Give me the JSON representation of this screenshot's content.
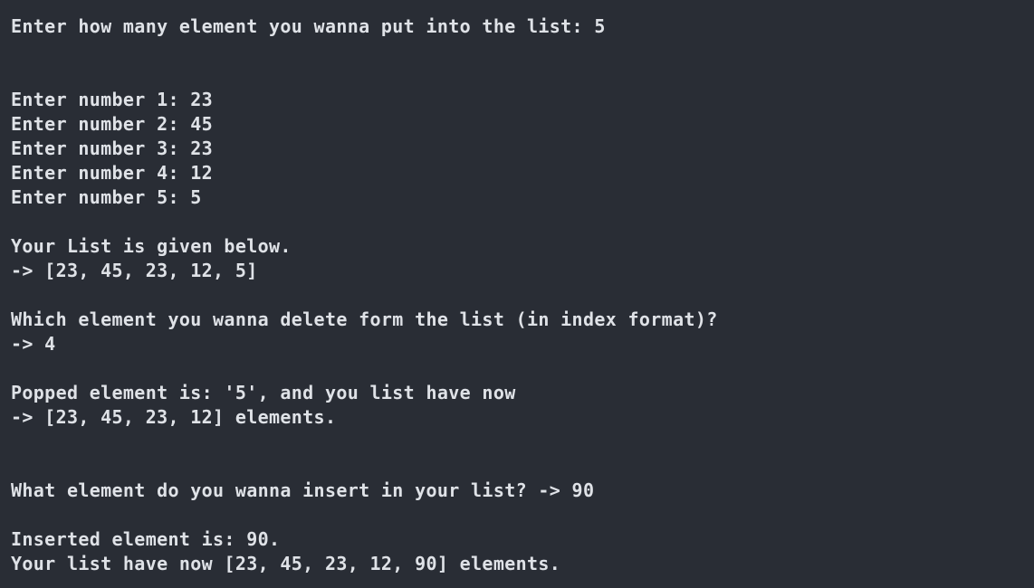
{
  "terminal": {
    "lines": {
      "count_prompt": "Enter how many element you wanna put into the list: 5",
      "num1": "Enter number 1: 23",
      "num2": "Enter number 2: 45",
      "num3": "Enter number 3: 23",
      "num4": "Enter number 4: 12",
      "num5": "Enter number 5: 5",
      "list_header": "Your List is given below.",
      "list_value": "-> [23, 45, 23, 12, 5]",
      "delete_prompt": "Which element you wanna delete form the list (in index format)?",
      "delete_input": "-> 4",
      "popped_msg": "Popped element is: '5', and you list have now",
      "popped_list": "-> [23, 45, 23, 12] elements.",
      "insert_prompt": "What element do you wanna insert in your list? -> 90",
      "inserted_msg": "Inserted element is: 90.",
      "final_list": "Your list have now [23, 45, 23, 12, 90] elements."
    }
  }
}
